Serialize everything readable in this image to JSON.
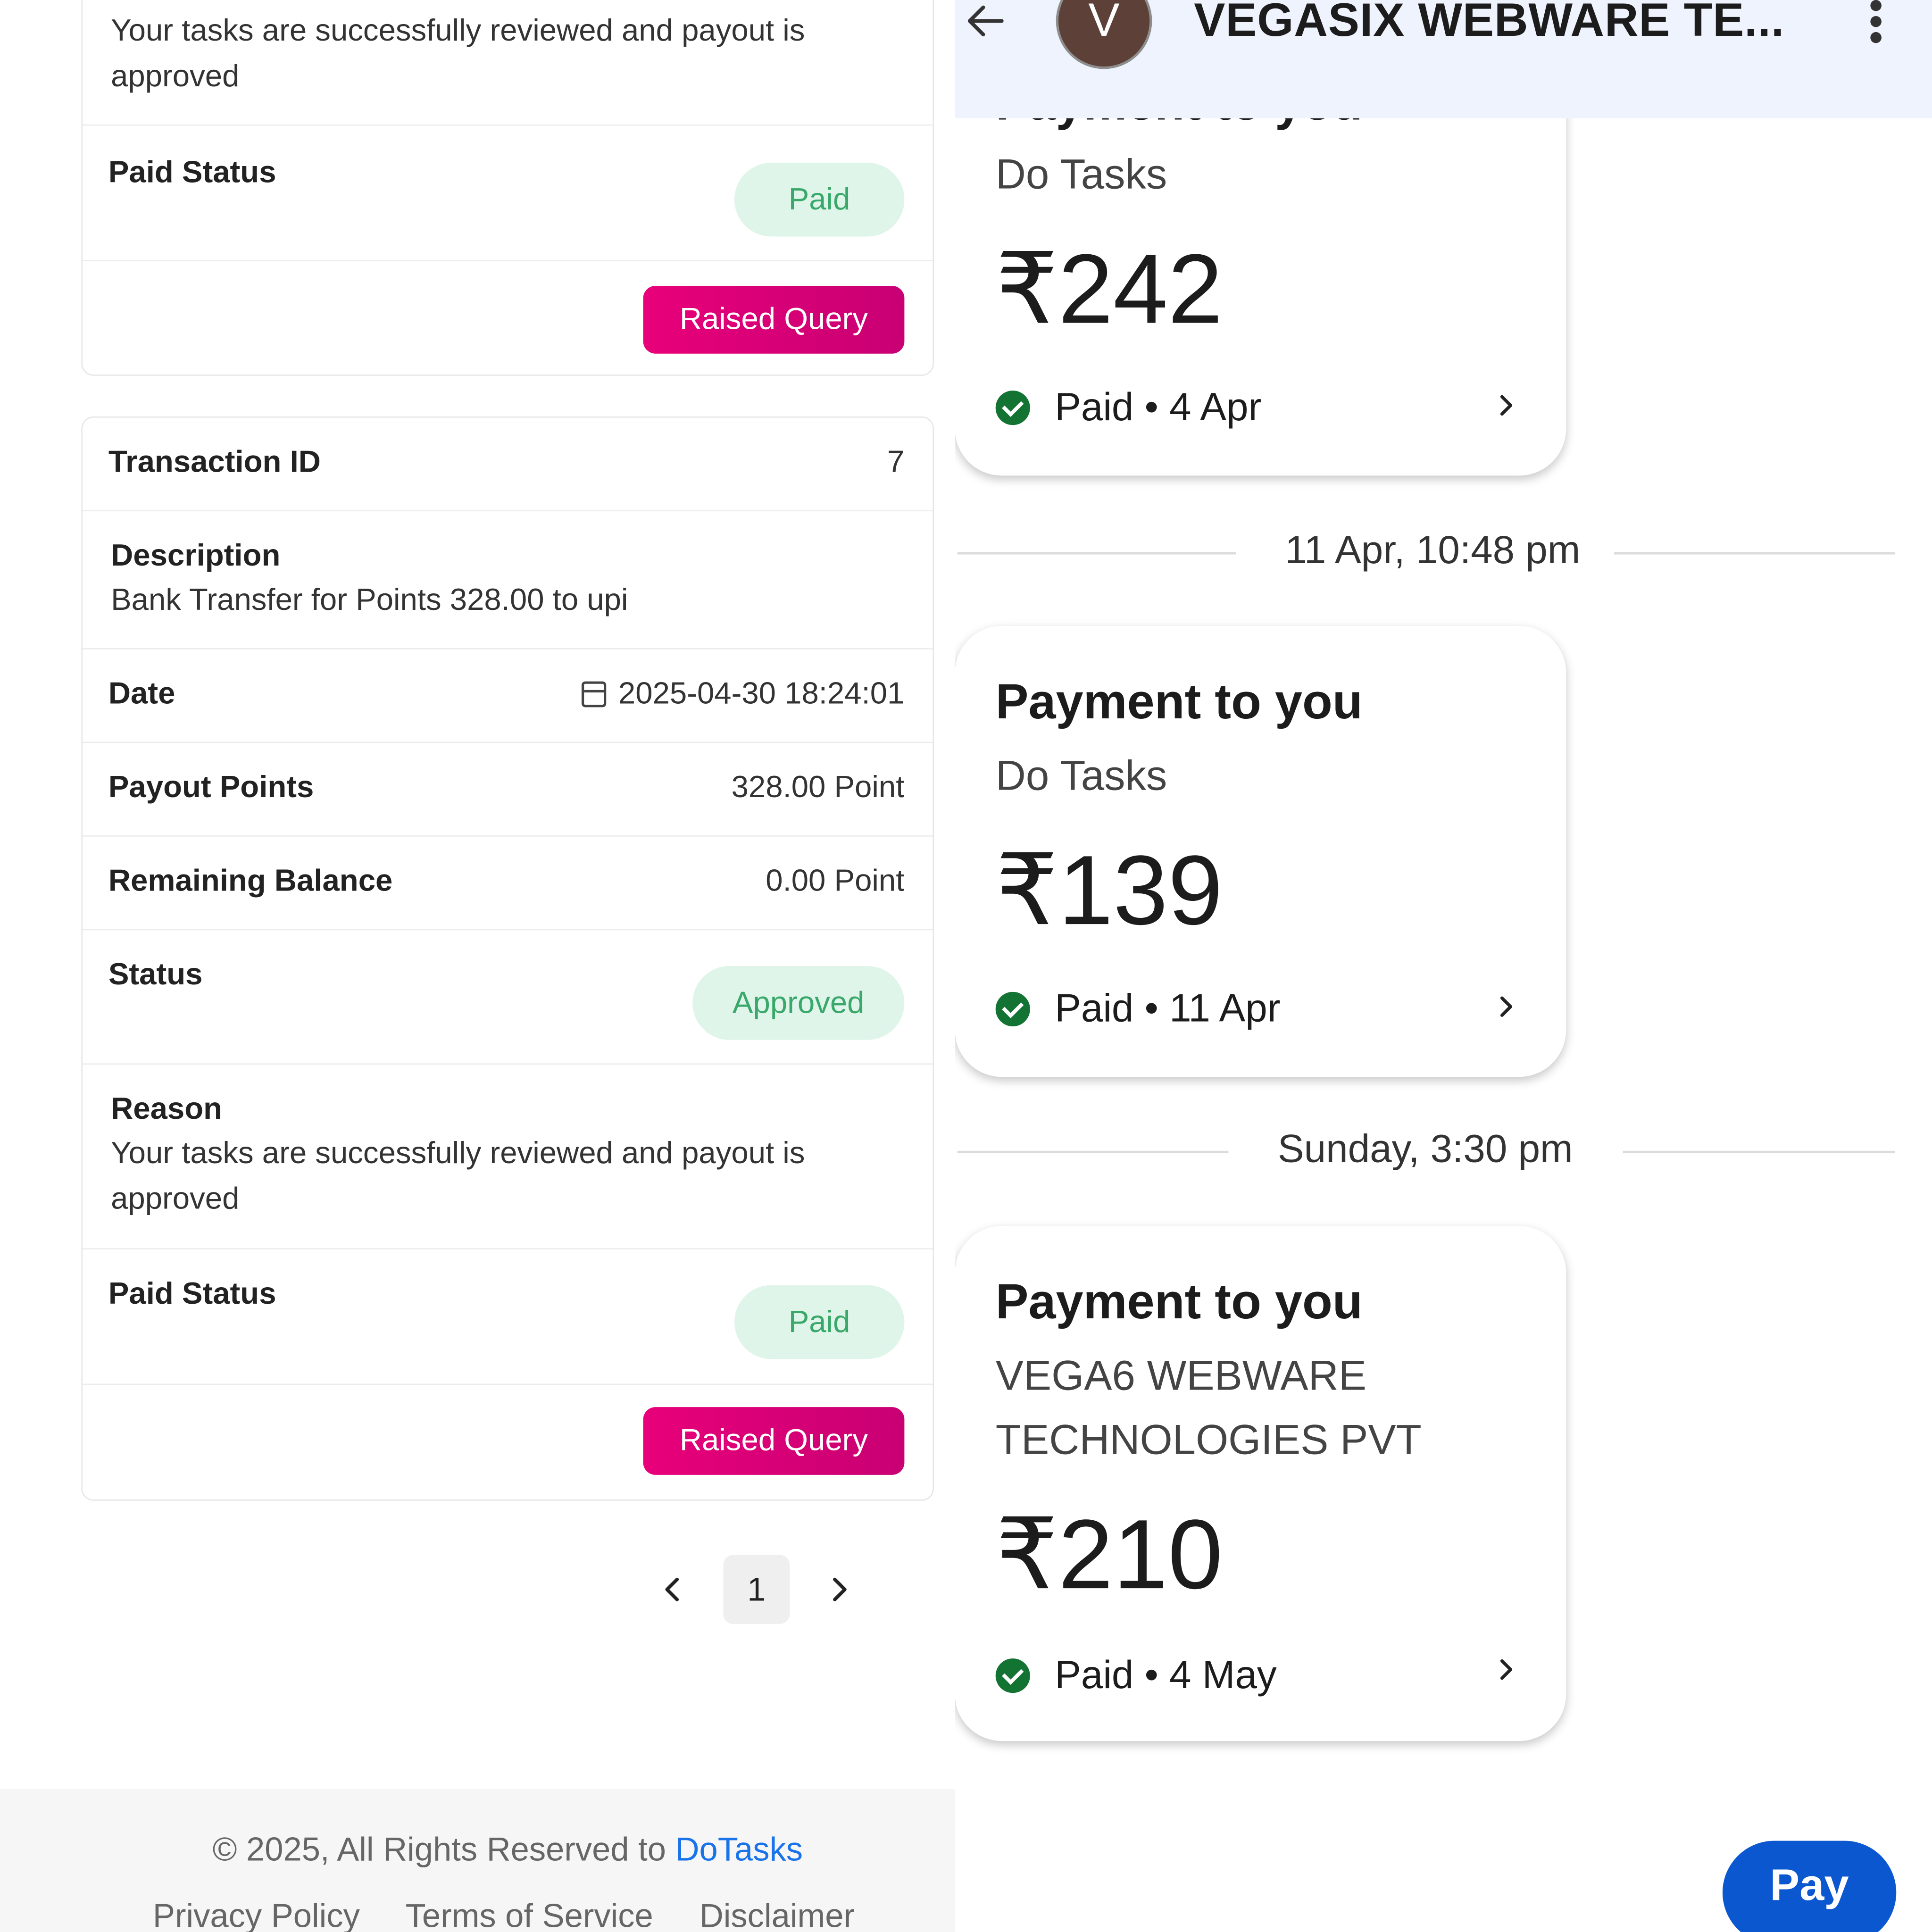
{
  "left": {
    "card1": {
      "reason_text": "Your tasks are successfully reviewed and payout is approved",
      "paid_status_label": "Paid Status",
      "paid_status_value": "Paid",
      "raised_query_label": "Raised Query"
    },
    "card2": {
      "transaction_id_label": "Transaction ID",
      "transaction_id_value": "7",
      "description_label": "Description",
      "description_value": "Bank Transfer for Points 328.00 to upi",
      "date_label": "Date",
      "date_value": "2025-04-30 18:24:01",
      "payout_label": "Payout Points",
      "payout_value": "328.00 Point",
      "remaining_label": "Remaining Balance",
      "remaining_value": "0.00 Point",
      "status_label": "Status",
      "status_value": "Approved",
      "reason_label": "Reason",
      "reason_text": "Your tasks are successfully reviewed and payout is approved",
      "paid_status_label": "Paid Status",
      "paid_status_value": "Paid",
      "raised_query_label": "Raised Query"
    },
    "pagination": {
      "current_page": "1"
    },
    "footer": {
      "copyright_prefix": "© 2025, All Rights Reserved to ",
      "brand": "DoTasks",
      "links": [
        "Privacy Policy",
        "Terms of Service",
        "Disclaimer"
      ]
    }
  },
  "right": {
    "header": {
      "avatar_letter": "V",
      "title": "VEGASIX WEBWARE TE..."
    },
    "payments": [
      {
        "title": "Payment to you",
        "payer": "Do Tasks",
        "amount": "₹242",
        "status": "Paid • 4 Apr"
      },
      {
        "title": "Payment to you",
        "payer": "Do Tasks",
        "amount": "₹139",
        "status": "Paid • 11 Apr"
      },
      {
        "title": "Payment to you",
        "payer": "VEGA6 WEBWARE TECHNOLOGIES PVT",
        "amount": "₹210",
        "status": "Paid • 4 May"
      }
    ],
    "separators": [
      "11 Apr, 10:48 pm",
      "Sunday, 3:30 pm"
    ],
    "pay_button": "Pay"
  },
  "colors": {
    "raised_query": "#e8007a",
    "paid_pill_bg": "#dff5ea",
    "paid_pill_text": "#3aa86b",
    "pay_button": "#0b57d0",
    "paid_tick": "#137333",
    "brand_link": "#1a73e8",
    "avatar": "#5d4037"
  },
  "icons": [
    "calendar-icon",
    "chevron-left-icon",
    "chevron-right-icon",
    "back-arrow-icon",
    "more-vert-icon",
    "check-circle-icon"
  ]
}
